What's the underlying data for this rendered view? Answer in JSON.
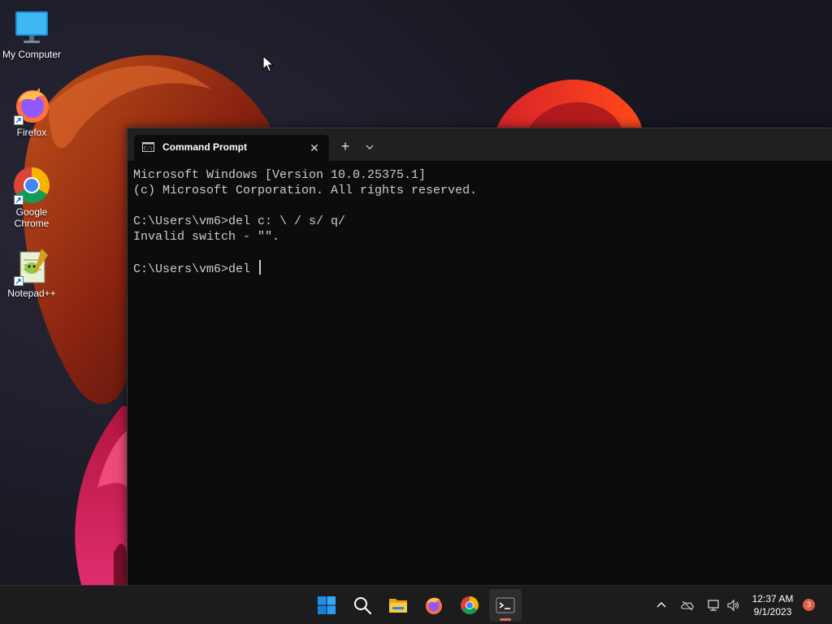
{
  "desktop": {
    "icons": [
      {
        "label": "My Computer",
        "icon": "monitor-icon"
      },
      {
        "label": "Firefox",
        "icon": "firefox-icon"
      },
      {
        "label": "Google\nChrome",
        "icon": "chrome-icon"
      },
      {
        "label": "Notepad++",
        "icon": "notepadpp-icon"
      }
    ]
  },
  "terminal": {
    "tab": {
      "title": "Command Prompt",
      "close_symbol": "✕",
      "icon": "cmd-icon"
    },
    "new_tab_symbol": "+",
    "dropdown_icon": "chevron-down-icon",
    "lines": [
      "Microsoft Windows [Version 10.0.25375.1]",
      "(c) Microsoft Corporation. All rights reserved.",
      "",
      "C:\\Users\\vm6>del c: \\ / s/ q/",
      "Invalid switch - \"\".",
      "",
      "C:\\Users\\vm6>del "
    ],
    "colors": {
      "background": "#0c0c0c",
      "text": "#cccccc",
      "tabbar": "#202020"
    }
  },
  "taskbar": {
    "buttons": [
      {
        "name": "start-button",
        "icon": "windows-logo-icon"
      },
      {
        "name": "search-button",
        "icon": "search-icon"
      },
      {
        "name": "file-explorer-button",
        "icon": "folder-icon"
      },
      {
        "name": "firefox-taskbar-button",
        "icon": "firefox-icon"
      },
      {
        "name": "chrome-taskbar-button",
        "icon": "chrome-icon"
      },
      {
        "name": "terminal-taskbar-button",
        "icon": "terminal-icon",
        "active": true
      }
    ],
    "tray_icons": [
      "chevron-up-icon",
      "onedrive-offline-icon",
      "network-icon",
      "volume-icon"
    ],
    "clock": {
      "time": "12:37 AM",
      "date": "9/1/2023"
    },
    "notifications": {
      "count": "3"
    },
    "accent": "#e66b57"
  }
}
